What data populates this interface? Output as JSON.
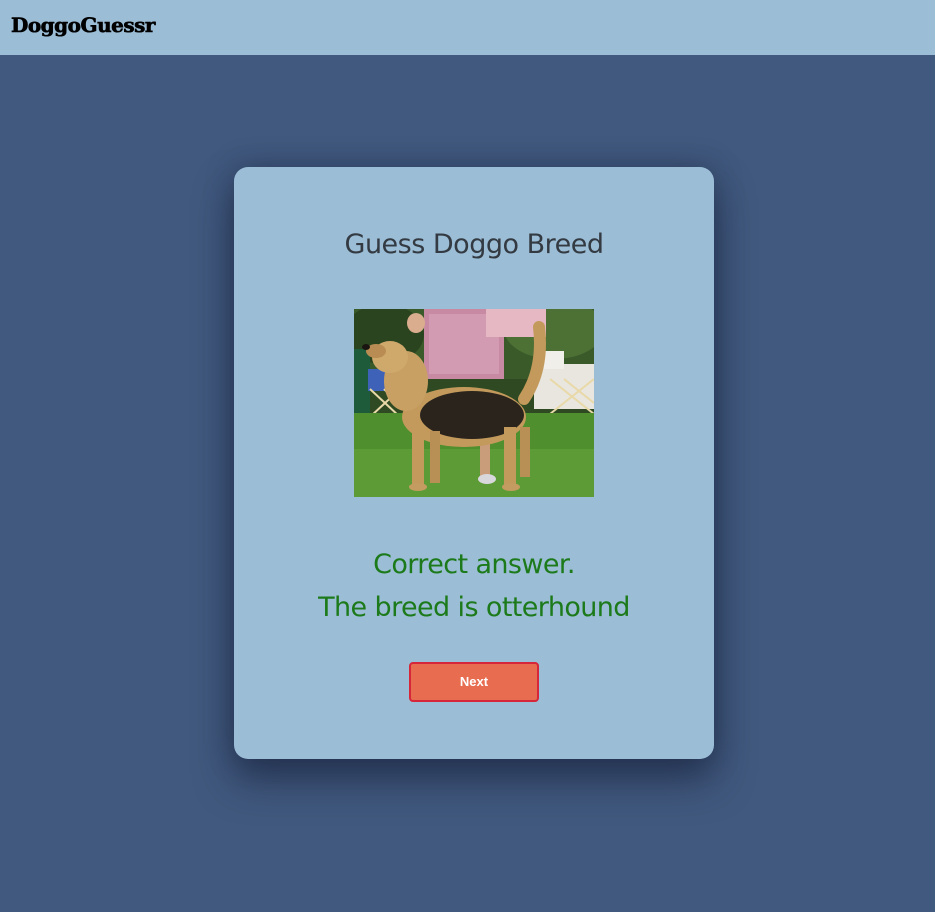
{
  "header": {
    "brand": "DoggoGuessr"
  },
  "quiz": {
    "title": "Guess Doggo Breed",
    "image_alt": "otterhound",
    "result_line1": "Correct answer.",
    "result_line2": "The breed is otterhound",
    "next_label": "Next"
  },
  "colors": {
    "page_background": "#41597e",
    "panel": "#9bbdd6",
    "success_text": "#1c7a1a",
    "button": "#e86c4f",
    "button_border": "#d6263a"
  }
}
